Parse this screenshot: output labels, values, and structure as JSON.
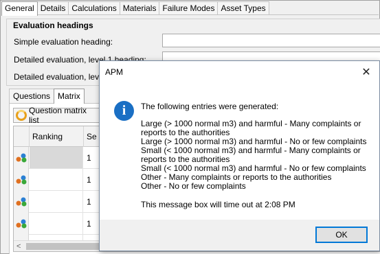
{
  "top_tabs": [
    "General",
    "Details",
    "Calculations",
    "Materials",
    "Failure Modes",
    "Asset Types"
  ],
  "evaluation": {
    "title": "Evaluation headings",
    "simple_label": "Simple evaluation  heading:",
    "detailed1_label": "Detailed evaluation, level 1 heading:",
    "detailed2_label": "Detailed evaluation, level"
  },
  "sub_tabs": [
    "Questions",
    "Matrix"
  ],
  "matrix": {
    "list_button": "Question matrix list",
    "columns": {
      "ranking": "Ranking",
      "seq": "Se"
    },
    "rows": [
      {
        "seq": "1"
      },
      {
        "seq": "1"
      },
      {
        "seq": "1"
      },
      {
        "seq": "1"
      },
      {
        "seq": "1"
      }
    ],
    "scroll_left": "<"
  },
  "dialog": {
    "title": "APM",
    "close": "✕",
    "intro": "The following entries were generated:",
    "entries": [
      "Large (> 1000 normal m3) and harmful - Many complaints or\nreports to the authorities",
      "Large (> 1000 normal m3) and harmful - No or few complaints",
      "Small (< 1000 normal m3) and harmful - Many complaints or\nreports to the authorities",
      "Small (< 1000 normal m3) and harmful - No or few complaints",
      "Other - Many complaints or reports to the authorities",
      "Other - No or few complaints"
    ],
    "timeout": "This message box will time out at 2:08 PM",
    "ok": "OK",
    "info_glyph": "i"
  }
}
